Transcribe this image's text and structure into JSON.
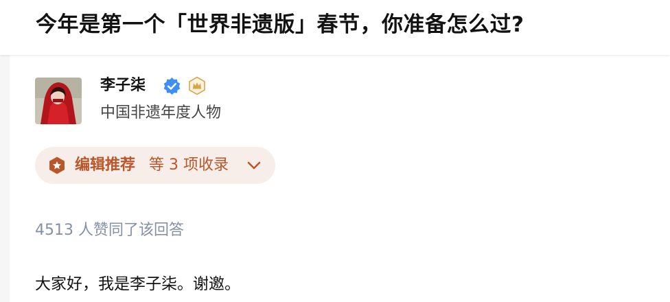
{
  "question": {
    "title": "今年是第一个「世界非遗版」春节，你准备怎么过?"
  },
  "author": {
    "name": "李子柒",
    "bio": "中国非遗年度人物",
    "avatar_icon": "avatar-red-cloak",
    "badges": [
      "verified-check-icon",
      "crown-badge-icon"
    ]
  },
  "collection": {
    "strong_label": "编辑推荐",
    "rest_label": "等 3 项收录",
    "icon": "hexagon-badge-icon",
    "accent_color": "#b8572c",
    "background_color": "#f8eee9"
  },
  "answer": {
    "votes_text": "4513 人赞同了该回答",
    "first_paragraph": "大家好，我是李子柒。谢邀。"
  }
}
